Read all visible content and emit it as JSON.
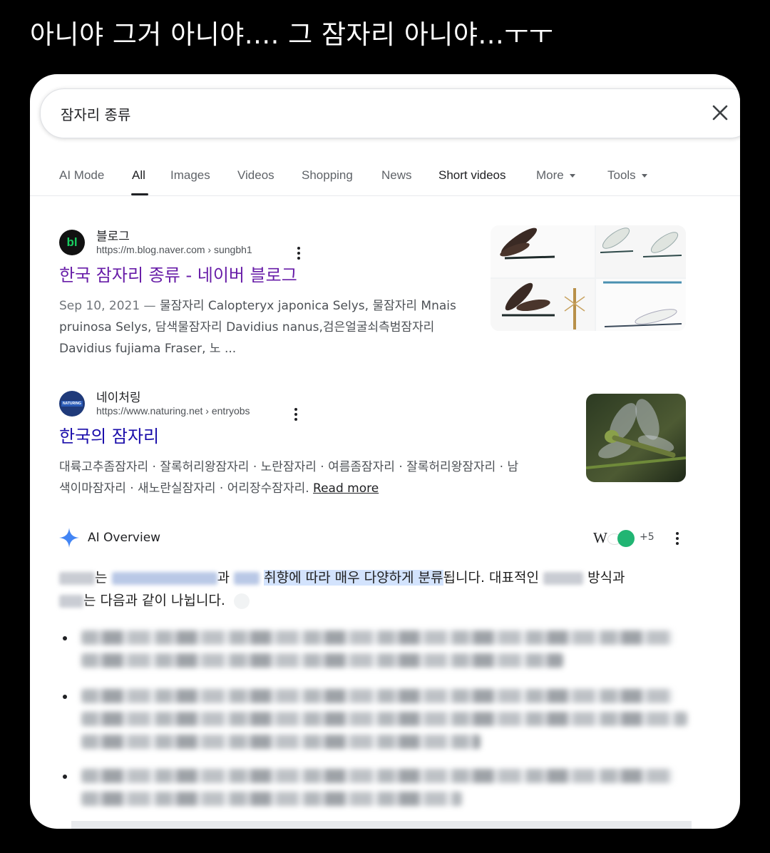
{
  "caption": "아니야 그거 아니야.... 그 잠자리 아니야...ㅜㅜ",
  "search": {
    "query": "잠자리 종류"
  },
  "tabs": [
    {
      "label": "AI Mode"
    },
    {
      "label": "All"
    },
    {
      "label": "Images"
    },
    {
      "label": "Videos"
    },
    {
      "label": "Shopping"
    },
    {
      "label": "News"
    },
    {
      "label": "Short videos"
    },
    {
      "label": "More"
    },
    {
      "label": "Tools"
    }
  ],
  "results": [
    {
      "site_name": "블로그",
      "favicon_text": "bl",
      "url": "https://m.blog.naver.com › sungbh1",
      "title": "한국 잠자리 종류 - 네이버 블로그",
      "date": "Sep 10, 2021 —",
      "snippet_lines": [
        " 물잠자리 Calopteryx japonica Selys, 물잠자리 Mnais",
        "pruinosa Selys, 담색물잠자리 Davidius nanus,검은얼굴쇠측범잠자리",
        "Davidius fujiama Fraser, 노 ..."
      ]
    },
    {
      "site_name": "네이처링",
      "favicon_text": "NATURING",
      "url": "https://www.naturing.net › entryobs",
      "title": "한국의 잠자리",
      "snippet_lines": [
        "대륙고추좀잠자리 · 잘록허리왕잠자리 · 노란잠자리 · 여름좀잠자리 · 잘록허리왕잠자리 · 남",
        "색이마잠자리 · 새노란실잠자리 · 어리장수잠자리."
      ],
      "read_more": "Read more"
    }
  ],
  "ai_overview": {
    "label": "AI Overview",
    "sources_wiki": "W",
    "sources_more": "+5",
    "intro_part1": "는",
    "intro_part2": "과",
    "intro_highlight": "취향에 따라 매우 다양하게 분류",
    "intro_part3": "됩니다. 대표적인",
    "intro_part4": "방식과",
    "intro_part5": "는 다음과 같이 나뉩니다."
  },
  "colors": {
    "visited_link": "#681da8",
    "link": "#1a0dab",
    "highlight": "#d3e3fd",
    "ai_star": "#4285f4"
  }
}
